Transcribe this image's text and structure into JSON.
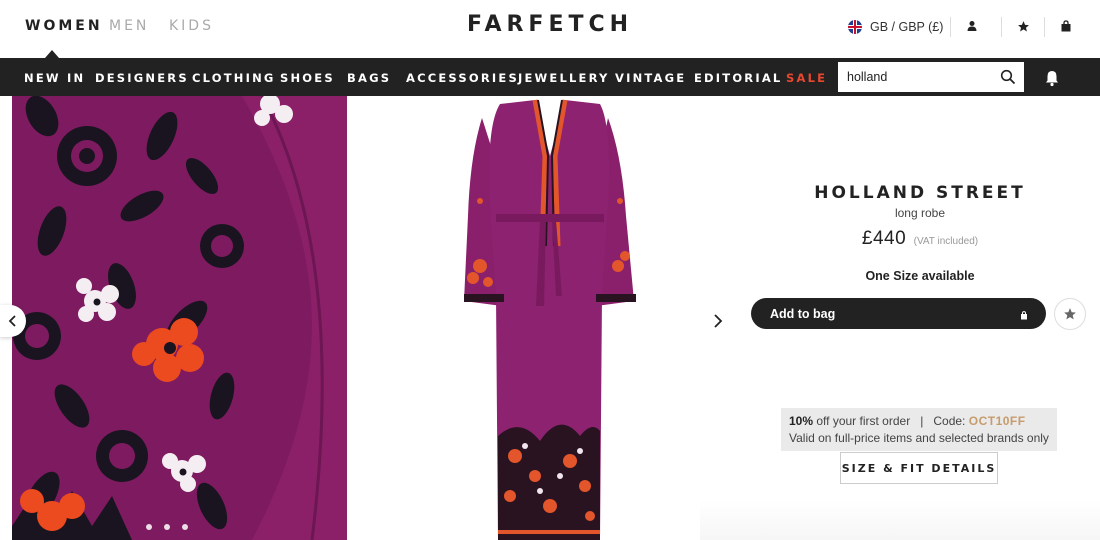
{
  "header": {
    "genders": [
      {
        "label": "WOMEN",
        "active": true
      },
      {
        "label": "MEN",
        "active": false
      },
      {
        "label": "KIDS",
        "active": false
      }
    ],
    "logo": "FARFETCH",
    "region": "GB / GBP (£)",
    "icons": [
      "uk-flag-icon",
      "user-icon",
      "star-icon",
      "bag-icon"
    ]
  },
  "nav": {
    "items": [
      "NEW IN",
      "DESIGNERS",
      "CLOTHING",
      "SHOES",
      "BAGS",
      "ACCESSORIES",
      "JEWELLERY",
      "VINTAGE",
      "EDITORIAL",
      "SALE"
    ],
    "search_value": "holland",
    "icons": [
      "search-icon",
      "bell-icon"
    ],
    "sale_color": "#e8472f"
  },
  "gallery": {
    "dots": 3,
    "icons": [
      "chevron-left-icon",
      "chevron-right-icon"
    ],
    "garment_color": "#8a1f6b"
  },
  "product": {
    "brand": "HOLLAND STREET",
    "name": "long robe",
    "price": "£440",
    "vat": "(VAT included)",
    "size_availability": "One Size available",
    "add_to_bag": "Add to bag",
    "promo": {
      "percent": "10%",
      "text": "off your first order",
      "divider": "|",
      "code_label": "Code:",
      "code": "OCT10FF",
      "note": "Valid on full-price items and selected brands only"
    },
    "size_fit": "SIZE & FIT DETAILS"
  }
}
